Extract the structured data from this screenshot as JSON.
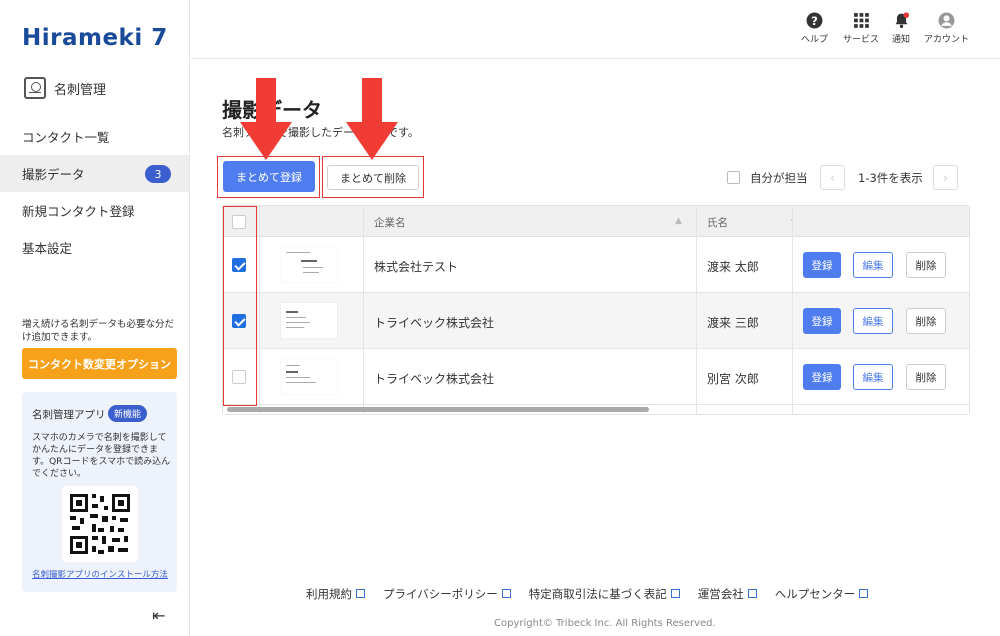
{
  "brand": {
    "logo_text": "Hirameki 7"
  },
  "header": {
    "items": [
      {
        "label": "ヘルプ",
        "icon": "help-circle-icon"
      },
      {
        "label": "サービス",
        "icon": "grid-icon"
      },
      {
        "label": "通知",
        "icon": "bell-icon"
      },
      {
        "label": "アカウント",
        "icon": "user-circle-icon"
      }
    ]
  },
  "sidebar": {
    "section_title": "名刺管理",
    "items": [
      {
        "label": "コンタクト一覧"
      },
      {
        "label": "撮影データ",
        "badge": "3"
      },
      {
        "label": "新規コンタクト登録"
      },
      {
        "label": "基本設定"
      }
    ],
    "promo_text": "増え続ける名刺データも必要な分だけ追加できます。",
    "promo_button": "コンタクト数変更オプション",
    "app": {
      "title": "名刺管理アプリ",
      "badge": "新機能",
      "description": "スマホのカメラで名刺を撮影してかんたんにデータを登録できます。QRコードをスマホで読み込んでください。",
      "link": "名刺撮影アプリのインストール方法"
    },
    "collapse_icon": "collapse-left-icon"
  },
  "main": {
    "title": "撮影データ",
    "subtitle": "名刺アプリで撮影したデータ一覧です。",
    "register_all": "まとめて登録",
    "delete_all": "まとめて削除",
    "self_assign_label": "自分が担当",
    "pager_text": "1-3件を表示",
    "table": {
      "headers": {
        "company": "企業名",
        "name": "氏名"
      },
      "rows": [
        {
          "checked": true,
          "company": "株式会社テスト",
          "name": "渡来 太郎"
        },
        {
          "checked": true,
          "company": "トライベック株式会社",
          "name": "渡来 三郎"
        },
        {
          "checked": false,
          "company": "トライベック株式会社",
          "name": "別宮 次郎"
        }
      ],
      "actions": {
        "register": "登録",
        "edit": "編集",
        "delete": "削除"
      }
    }
  },
  "footer": {
    "links": [
      "利用規約",
      "プライバシーポリシー",
      "特定商取引法に基づく表記",
      "運営会社",
      "ヘルプセンター"
    ],
    "copyright": "Copyright© Tribeck Inc. All Rights Reserved."
  },
  "colors": {
    "primary": "#4f7df0",
    "badge": "#3b5fcf",
    "accent": "#f7a11a",
    "annotation": "#e53935"
  }
}
